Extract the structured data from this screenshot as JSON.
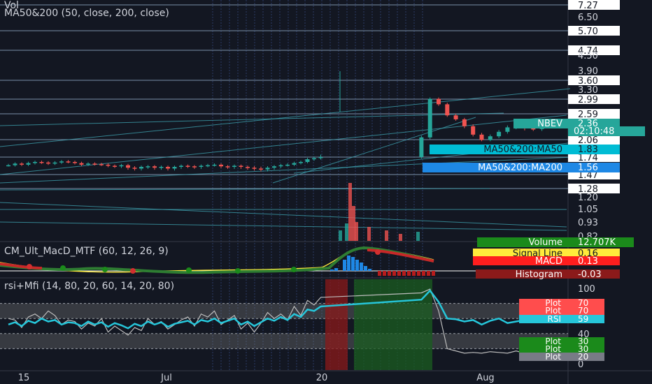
{
  "symbol": "NBEV",
  "countdown": "02:10:48",
  "studies": {
    "vol_label": "Vol",
    "ma_label": "MA50&200 (50, close, 200, close)",
    "macd_label": "CM_Ult_MacD_MTF (60, 12, 26, 9)",
    "rsi_label": "rsi+Mfi (14, 80, 20, 60, 14, 20, 80)"
  },
  "price_axis": {
    "ticks": [
      "7.27",
      "6.50",
      "5.70",
      "4.74",
      "4.50",
      "3.90",
      "3.60",
      "3.30",
      "2.99",
      "2.59",
      "2.36",
      "2.06",
      "1.83",
      "1.74",
      "1.56",
      "1.47",
      "1.28",
      "1.20",
      "1.05",
      "0.93",
      "0.82"
    ],
    "boxed_levels": [
      "7.27",
      "5.70",
      "4.74",
      "3.60",
      "2.99",
      "2.59",
      "2.06",
      "1.74",
      "1.47",
      "1.28"
    ]
  },
  "price_tags": {
    "symbol_tag": {
      "label": "NBEV",
      "value": "2.36",
      "color": "#26a69a"
    },
    "ma50": {
      "label": "MA50&200:MA50",
      "value": "1.83",
      "color": "#00bcd4"
    },
    "ma200": {
      "label": "MA50&200:MA200",
      "value": "1.56",
      "color": "#1e88e5"
    },
    "volume": {
      "label": "Volume",
      "value": "12.707K",
      "color": "#1b8a1b"
    }
  },
  "macd_axis": {
    "tags": [
      {
        "label": "Signal Line",
        "value": "0.16",
        "color": "#ffeb3b",
        "text_color": "#131722"
      },
      {
        "label": "MACD",
        "value": "0.13",
        "color": "#ff1e1e",
        "text_color": "#ffffff"
      },
      {
        "label": "Histogram",
        "value": "-0.03",
        "color": "#8b1a1a",
        "text_color": "#ffffff"
      }
    ]
  },
  "rsi_axis": {
    "ticks": [
      "100",
      "80",
      "60",
      "40",
      "20",
      "0"
    ],
    "tags": [
      {
        "label": "Plot",
        "value": "70",
        "color": "#ff4d4d"
      },
      {
        "label": "Plot",
        "value": "70",
        "color": "#ff4d4d"
      },
      {
        "label": "RSI",
        "value": "59",
        "color": "#26c6da"
      },
      {
        "label": "Plot",
        "value": "30",
        "color": "#1b8a1b"
      },
      {
        "label": "Plot",
        "value": "30",
        "color": "#1b8a1b"
      },
      {
        "label": "Plot",
        "value": "20",
        "color": "#787b86"
      }
    ]
  },
  "time_axis": {
    "labels": [
      "15",
      "Jul",
      "20",
      "Aug"
    ]
  },
  "colors": {
    "up": "#26a69a",
    "down": "#ef5350",
    "background": "#131722",
    "grid": "#2a3a5e",
    "trendline": "#3fa7b5"
  },
  "chart_data": {
    "type": "candlestick",
    "price_closes": [
      1.59,
      1.62,
      1.6,
      1.63,
      1.65,
      1.64,
      1.62,
      1.64,
      1.66,
      1.65,
      1.63,
      1.6,
      1.62,
      1.61,
      1.6,
      1.58,
      1.57,
      1.59,
      1.55,
      1.54,
      1.56,
      1.57,
      1.55,
      1.56,
      1.54,
      1.56,
      1.58,
      1.57,
      1.56,
      1.58,
      1.59,
      1.6,
      1.57,
      1.56,
      1.58,
      1.56,
      1.55,
      1.54,
      1.53,
      1.55,
      1.57,
      1.59,
      1.6,
      1.63,
      1.65,
      1.7,
      1.72,
      1.74,
      2.1,
      3.0,
      2.85,
      2.55,
      2.45,
      2.3,
      2.15,
      2.05,
      2.12,
      2.2,
      2.28,
      2.3,
      2.26,
      2.25,
      2.3,
      2.36
    ],
    "rsi_values": [
      52,
      55,
      50,
      57,
      54,
      60,
      56,
      58,
      52,
      55,
      54,
      50,
      56,
      52,
      55,
      49,
      54,
      51,
      47,
      53,
      50,
      56,
      52,
      55,
      49,
      53,
      55,
      57,
      52,
      58,
      56,
      60,
      54,
      57,
      60,
      52,
      56,
      50,
      55,
      60,
      57,
      62,
      58,
      66,
      62,
      72,
      70,
      76,
      85,
      97,
      82,
      60,
      59,
      56,
      58,
      52,
      57,
      60,
      54,
      56,
      58,
      56,
      57,
      59
    ],
    "mfi_values": [
      60,
      58,
      48,
      62,
      66,
      60,
      70,
      64,
      52,
      58,
      56,
      46,
      54,
      50,
      60,
      42,
      50,
      44,
      38,
      48,
      44,
      60,
      52,
      56,
      46,
      52,
      58,
      62,
      50,
      66,
      62,
      70,
      52,
      58,
      64,
      46,
      54,
      42,
      54,
      68,
      60,
      66,
      58,
      76,
      64,
      84,
      78,
      88,
      94,
      99,
      70,
      20,
      17,
      14,
      15,
      14,
      16,
      15,
      14,
      17,
      14,
      14,
      20,
      26
    ],
    "rsi_ylim": [
      0,
      100
    ],
    "price_ylim": [
      0.8,
      7.3
    ]
  }
}
